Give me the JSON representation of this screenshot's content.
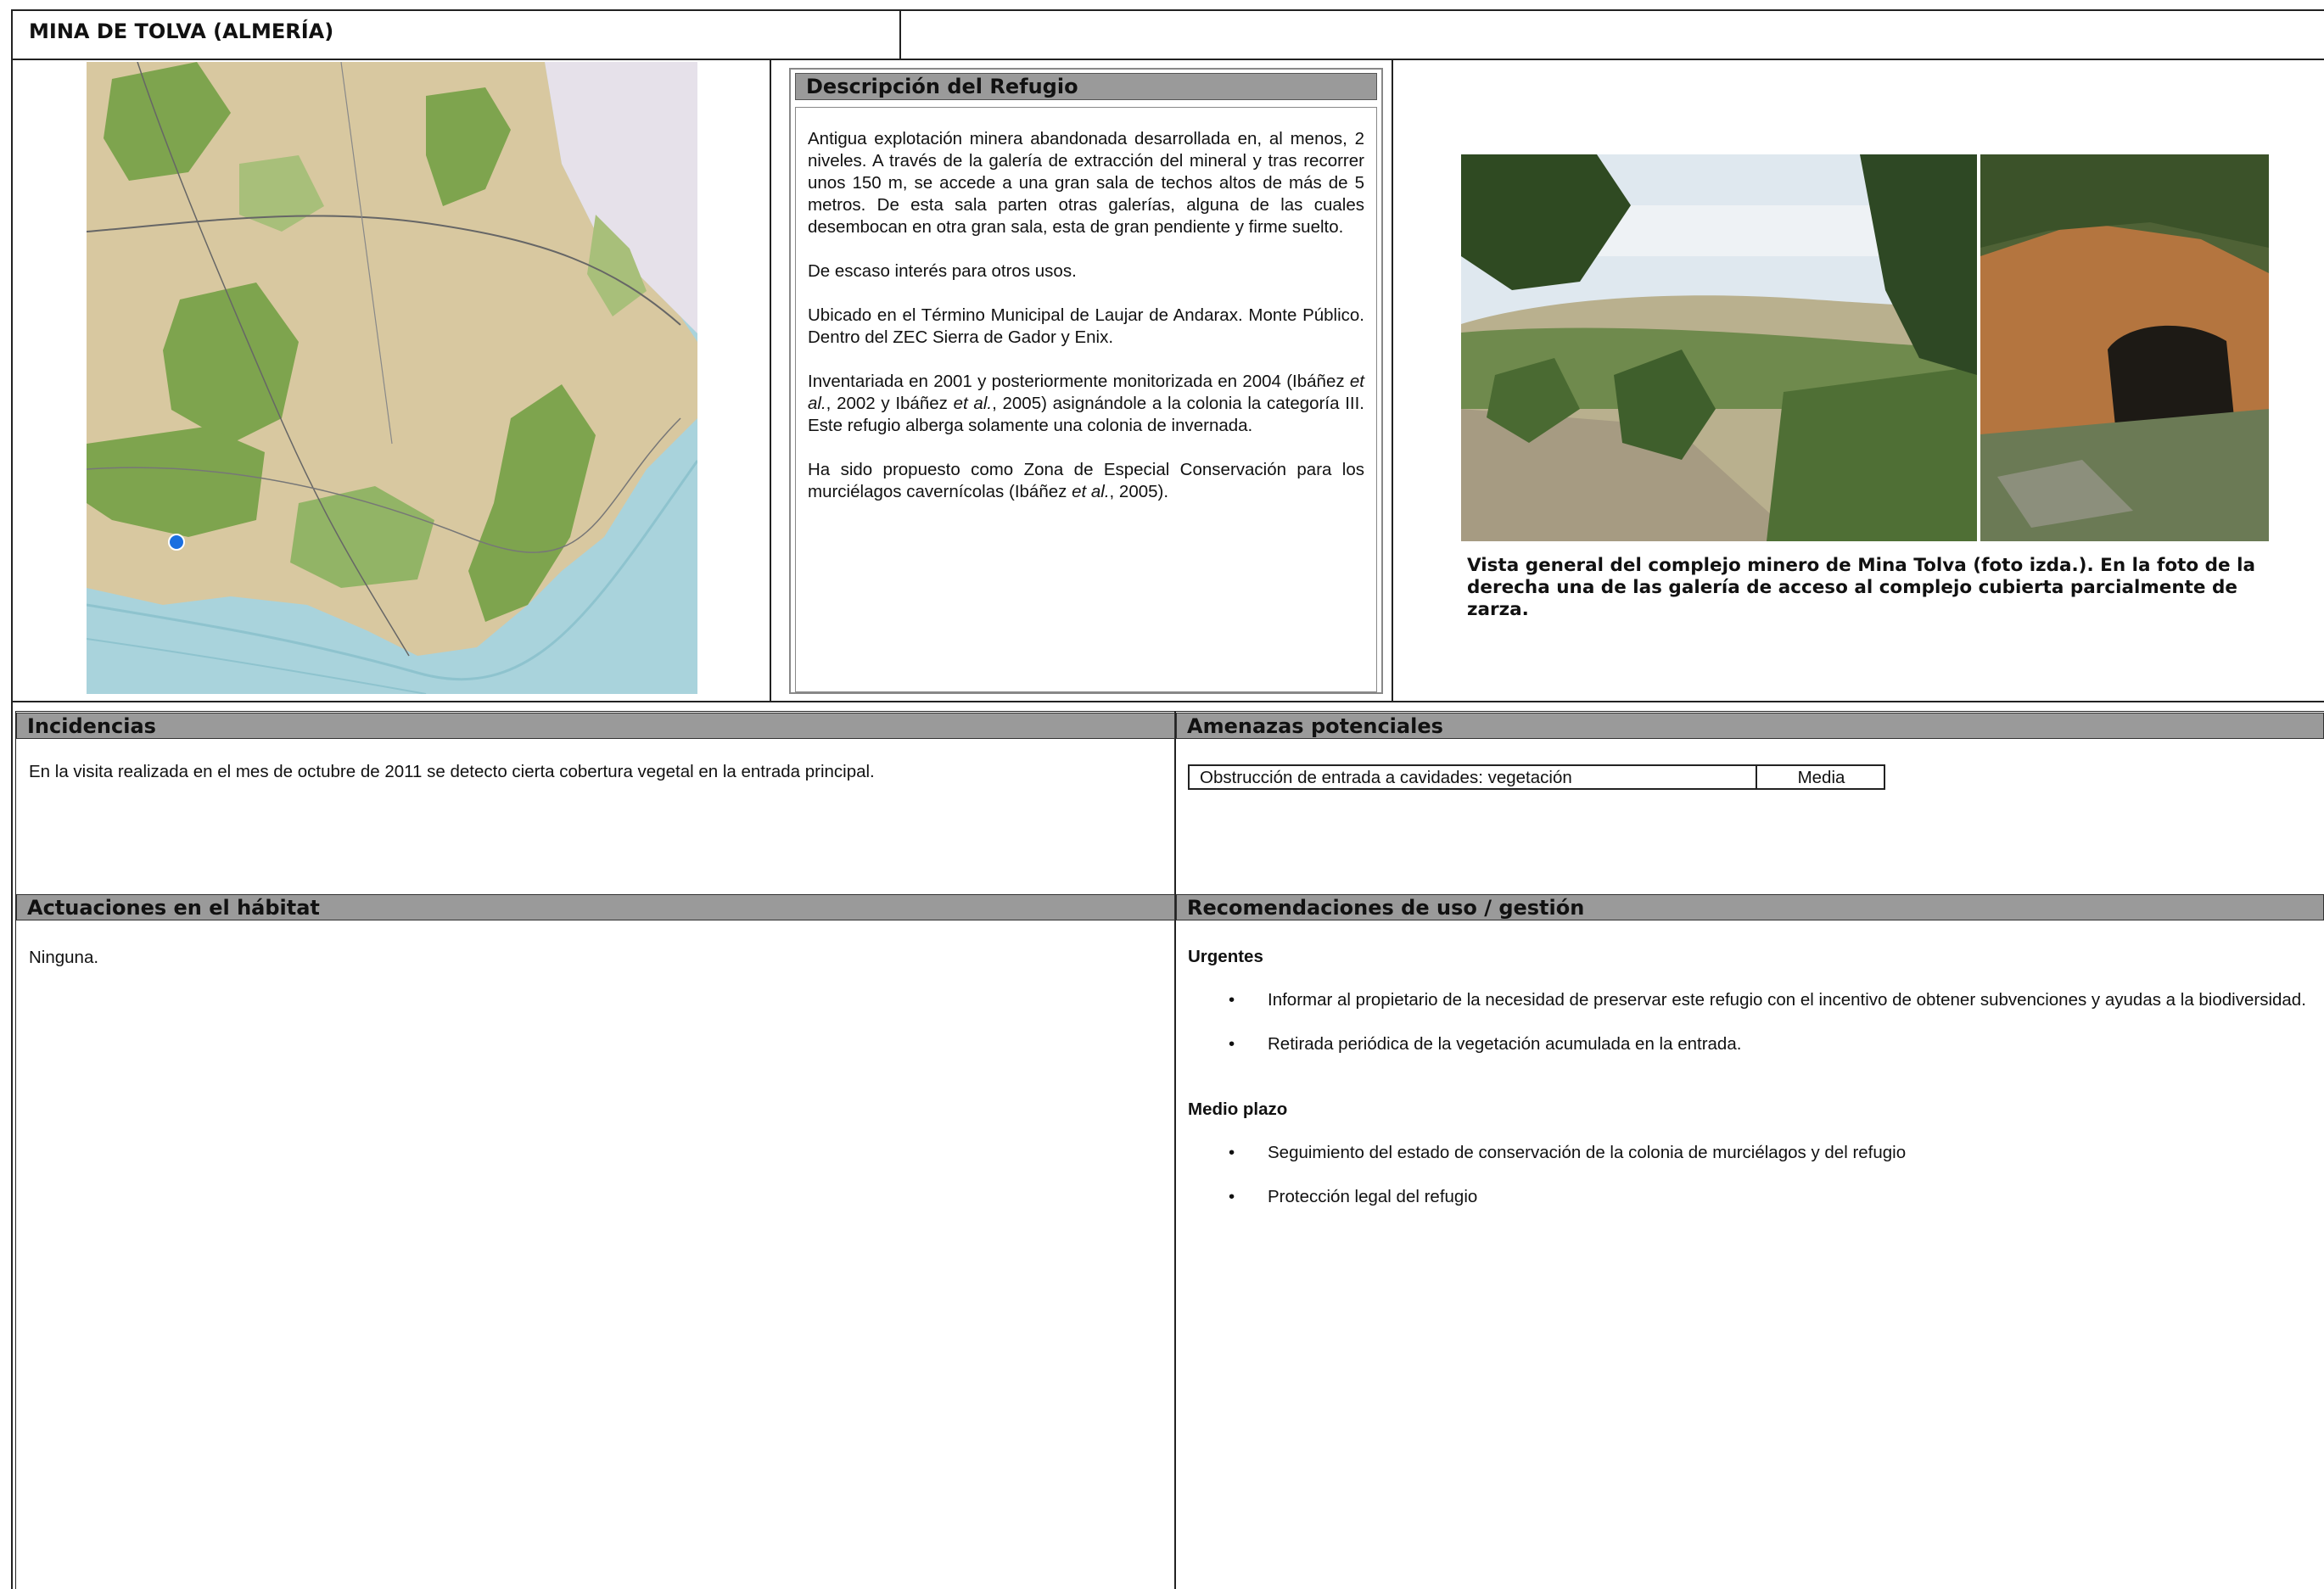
{
  "title": "MINA DE TOLVA (ALMERÍA)",
  "description": {
    "heading": "Descripción del Refugio",
    "p1": "Antigua explotación minera abandonada desarrollada en, al menos, 2 niveles. A través de la galería de extracción del mineral y tras recorrer unos 150 m, se accede a una gran sala de techos altos de más de 5 metros. De esta sala parten otras galerías, alguna de las cuales desembocan en otra gran sala, esta de gran pendiente y firme suelto.",
    "p2": "De escaso interés para otros usos.",
    "p3": "Ubicado en el Término Municipal de Laujar de Andarax. Monte Público. Dentro del ZEC Sierra de Gador y Enix.",
    "p4_a": "Inventariada en 2001 y posteriormente monitorizada en 2004 (Ibáñez ",
    "p4_etal1": "et al.",
    "p4_b": ", 2002 y Ibáñez ",
    "p4_etal2": "et al.",
    "p4_c": ", 2005) asignándole a la colonia la categoría III. Este refugio alberga solamente una colonia de invernada.",
    "p5_a": "Ha sido propuesto como Zona de Especial Conservación para los murciélagos cavernícolas (Ibáñez ",
    "p5_etal": "et al.",
    "p5_b": ", 2005)."
  },
  "photo_caption": "Vista general del complejo minero de Mina Tolva (foto izda.). En la foto de la derecha una de las galería de acceso al complejo cubierta parcialmente de zarza.",
  "incidencias": {
    "heading": "Incidencias",
    "text": "En la visita realizada en el mes de octubre de 2011 se detecto cierta cobertura vegetal en la entrada principal."
  },
  "amenazas": {
    "heading": "Amenazas potenciales",
    "rows": [
      {
        "threat": "Obstrucción de entrada a cavidades: vegetación",
        "level": "Media"
      }
    ]
  },
  "actuaciones": {
    "heading": "Actuaciones en el hábitat",
    "text": "Ninguna."
  },
  "recomendaciones": {
    "heading": "Recomendaciones de uso / gestión",
    "urgentes_label": "Urgentes",
    "urgentes": [
      "Informar al propietario de la necesidad de preservar este refugio con el incentivo de obtener subvenciones y ayudas a la biodiversidad.",
      "Retirada periódica de la vegetación acumulada en la entrada."
    ],
    "medio_label": "Medio plazo",
    "medio": [
      "Seguimiento del estado de conservación de la colonia de murciélagos y del refugio",
      "Protección legal del refugio"
    ],
    "bullet": "•"
  },
  "colors": {
    "header_bg": "#9a9a9a",
    "location_marker": "#1a6fe0",
    "sea": "#a9d3dc",
    "land": "#d8c8a0",
    "forest": "#7ea44e"
  }
}
